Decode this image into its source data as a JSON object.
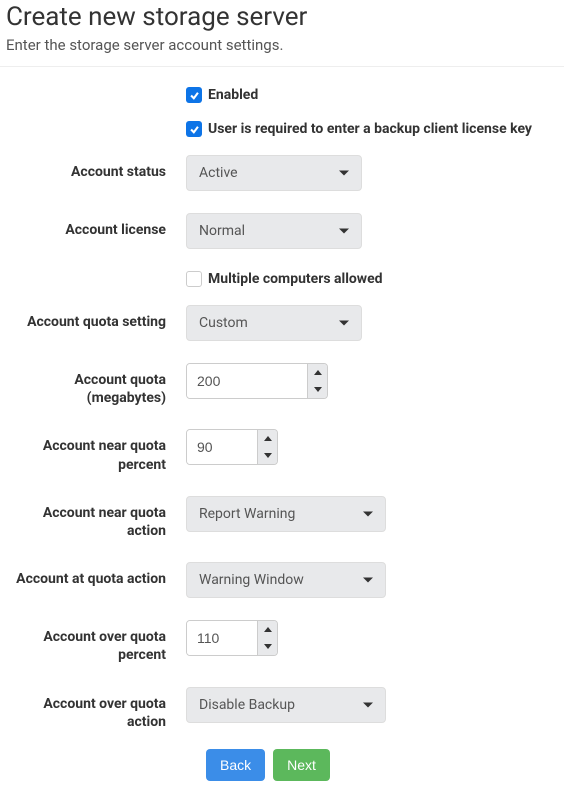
{
  "header": {
    "title": "Create new storage server",
    "subtitle": "Enter the storage server account settings."
  },
  "checkboxes": {
    "enabled": {
      "label": "Enabled",
      "checked": true
    },
    "license_required": {
      "label": "User is required to enter a backup client license key",
      "checked": true
    },
    "multiple_computers": {
      "label": "Multiple computers allowed",
      "checked": false
    }
  },
  "fields": {
    "account_status": {
      "label": "Account status",
      "value": "Active"
    },
    "account_license": {
      "label": "Account license",
      "value": "Normal"
    },
    "account_quota_setting": {
      "label": "Account quota setting",
      "value": "Custom"
    },
    "account_quota_mb": {
      "label": "Account quota (megabytes)",
      "value": "200"
    },
    "near_quota_percent": {
      "label": "Account near quota percent",
      "value": "90"
    },
    "near_quota_action": {
      "label": "Account near quota action",
      "value": "Report Warning"
    },
    "at_quota_action": {
      "label": "Account at quota action",
      "value": "Warning Window"
    },
    "over_quota_percent": {
      "label": "Account over quota percent",
      "value": "110"
    },
    "over_quota_action": {
      "label": "Account over quota action",
      "value": "Disable Backup"
    }
  },
  "buttons": {
    "back": "Back",
    "next": "Next"
  }
}
